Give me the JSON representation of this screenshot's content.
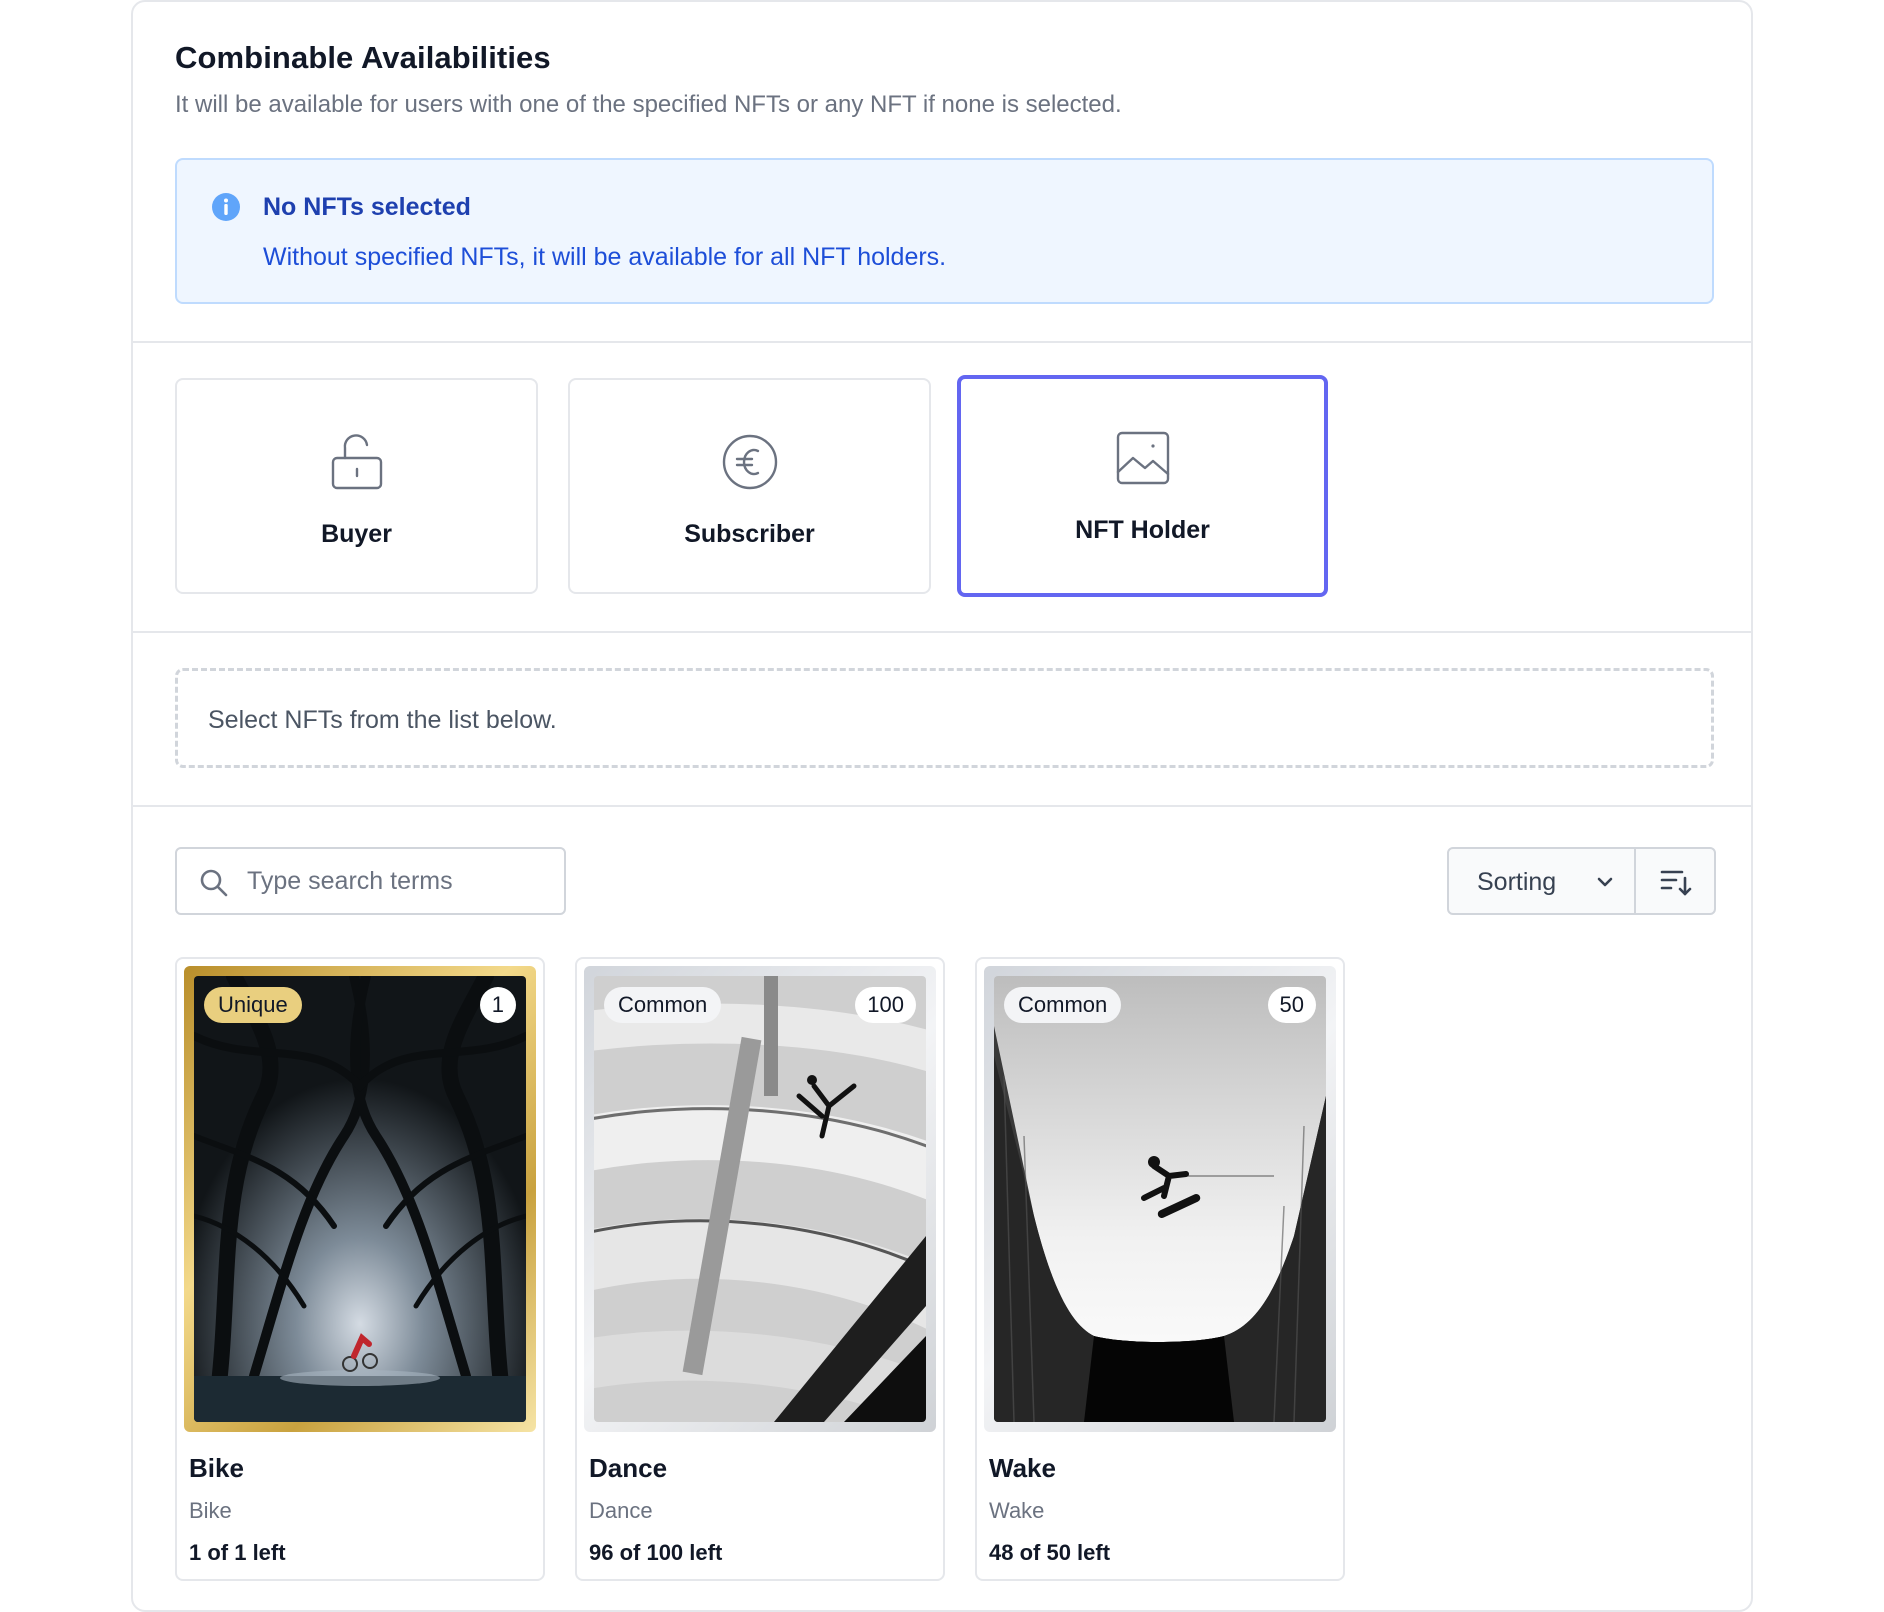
{
  "section": {
    "title": "Combinable Availabilities",
    "subtitle": "It will be available for users with one of the specified NFTs or any NFT if none is selected."
  },
  "alert": {
    "icon": "info-icon",
    "title": "No NFTs selected",
    "text": "Without specified NFTs, it will be available for all NFT holders."
  },
  "options": [
    {
      "label": "Buyer",
      "icon": "unlock-icon",
      "selected": false
    },
    {
      "label": "Subscriber",
      "icon": "euro-icon",
      "selected": false
    },
    {
      "label": "NFT Holder",
      "icon": "image-icon",
      "selected": true
    }
  ],
  "selection": {
    "empty_text": "Select NFTs from the list below."
  },
  "search": {
    "placeholder": "Type search terms",
    "value": ""
  },
  "sorting": {
    "label": "Sorting",
    "direction_icon": "sort-descending-icon"
  },
  "colors": {
    "accent": "#6366f1",
    "alert_bg": "#eff6ff",
    "alert_text": "#1d4ed8",
    "unique_gold": "#e9cf7f"
  },
  "nfts": [
    {
      "rarity": "Unique",
      "count": "1",
      "name": "Bike",
      "collection": "Bike",
      "availability": "1 of 1 left"
    },
    {
      "rarity": "Common",
      "count": "100",
      "name": "Dance",
      "collection": "Dance",
      "availability": "96 of 100 left"
    },
    {
      "rarity": "Common",
      "count": "50",
      "name": "Wake",
      "collection": "Wake",
      "availability": "48 of 50 left"
    }
  ]
}
